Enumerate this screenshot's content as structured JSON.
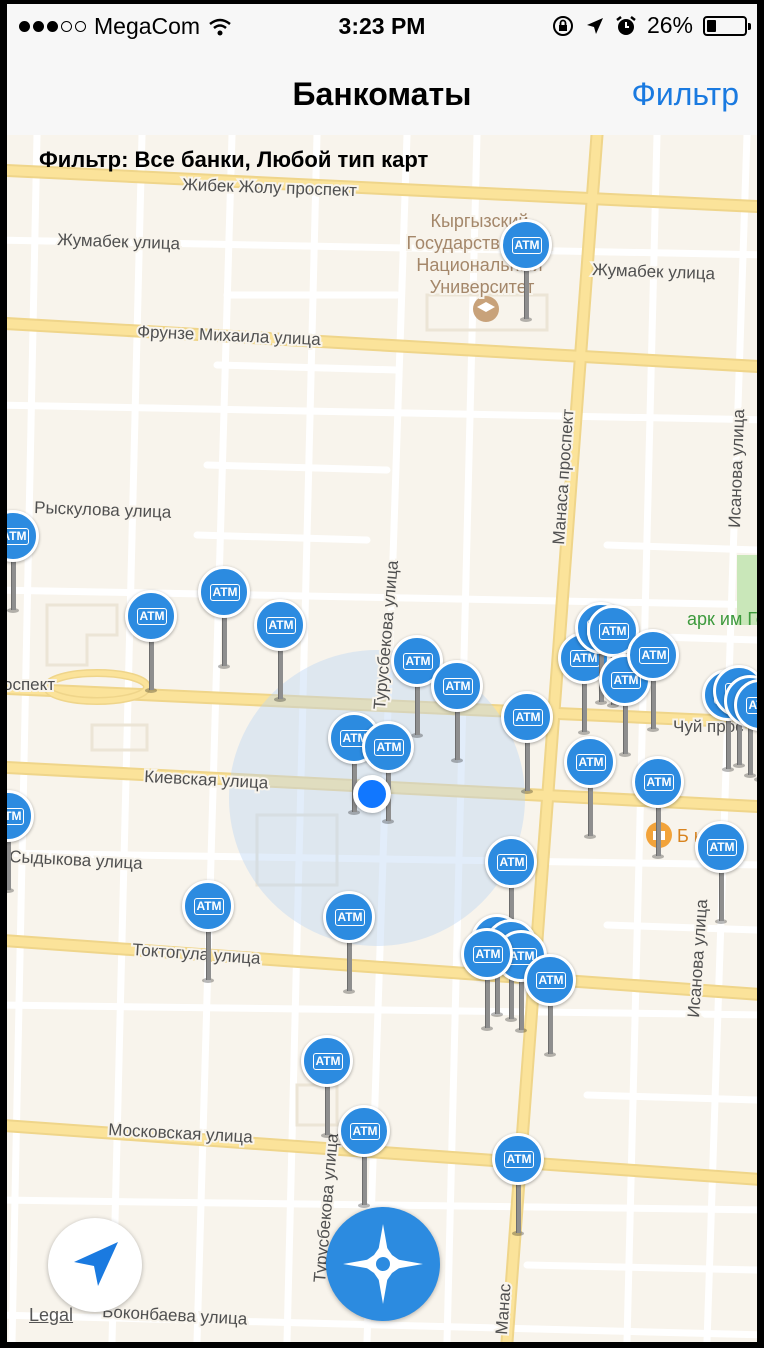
{
  "status_bar": {
    "carrier": "MegaCom",
    "time": "3:23 PM",
    "battery": "26%",
    "battery_level": 0.26,
    "icons": [
      "signal-dots",
      "wifi-icon",
      "rotation-lock-icon",
      "location-arrow-icon",
      "alarm-icon",
      "battery-icon"
    ]
  },
  "nav": {
    "title": "Банкоматы",
    "filter_button": "Фильтр"
  },
  "map": {
    "filter_caption": "Фильтр: Все банки, Любой тип карт",
    "legal": "Legal",
    "pin_label": "ATM",
    "streets": [
      "Жибек Жолу проспект",
      "Жумабек улица",
      "Жумабек улица",
      "Фрунзе Михаила улица",
      "Рыскулова улица",
      "Турусбекова улица",
      "Манаса проспект",
      "Исанова улица",
      "Чуй прос",
      "оспект",
      "Киевская улица",
      "Сыдыкова улица",
      "Токтогула улица",
      "Исанова улица",
      "Московская улица",
      "Турусбекова улица",
      "Боконбаева улица",
      "Манас"
    ],
    "poi": {
      "university": "Кыргызский Государственный Национальный Университет",
      "park": "арк им Гор",
      "shop": "Б      к"
    },
    "atm_count": 34
  },
  "colors": {
    "atm_pin": "#2c8be0",
    "accent": "#1a7ae0",
    "user_location": "#1177ff",
    "map_background": "#f8f4ec",
    "major_road": "#fbe39a"
  }
}
